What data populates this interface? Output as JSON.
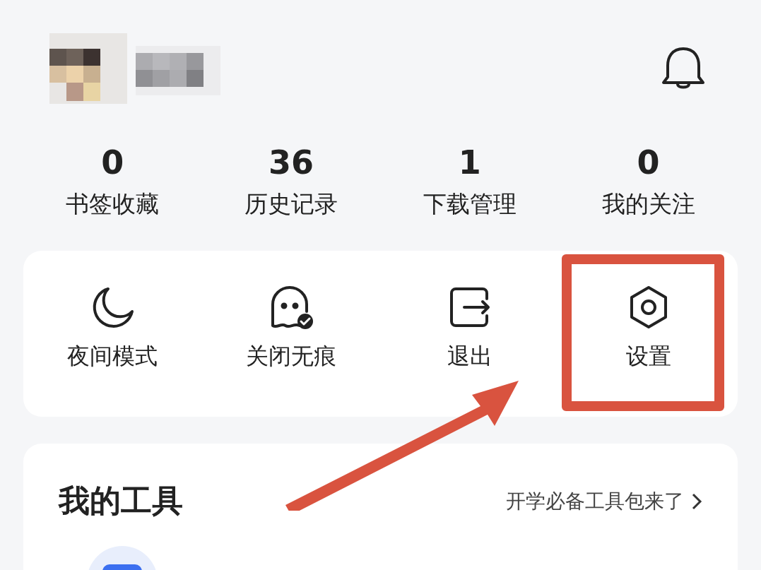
{
  "stats": [
    {
      "value": "0",
      "label": "书签收藏"
    },
    {
      "value": "36",
      "label": "历史记录"
    },
    {
      "value": "1",
      "label": "下载管理"
    },
    {
      "value": "0",
      "label": "我的关注"
    }
  ],
  "quick_actions": [
    {
      "kind": "moon",
      "label": "夜间模式"
    },
    {
      "kind": "ghost",
      "label": "关闭无痕"
    },
    {
      "kind": "exit",
      "label": "退出"
    },
    {
      "kind": "settings",
      "label": "设置"
    }
  ],
  "tools": {
    "title": "我的工具",
    "link": "开学必备工具包来了"
  }
}
